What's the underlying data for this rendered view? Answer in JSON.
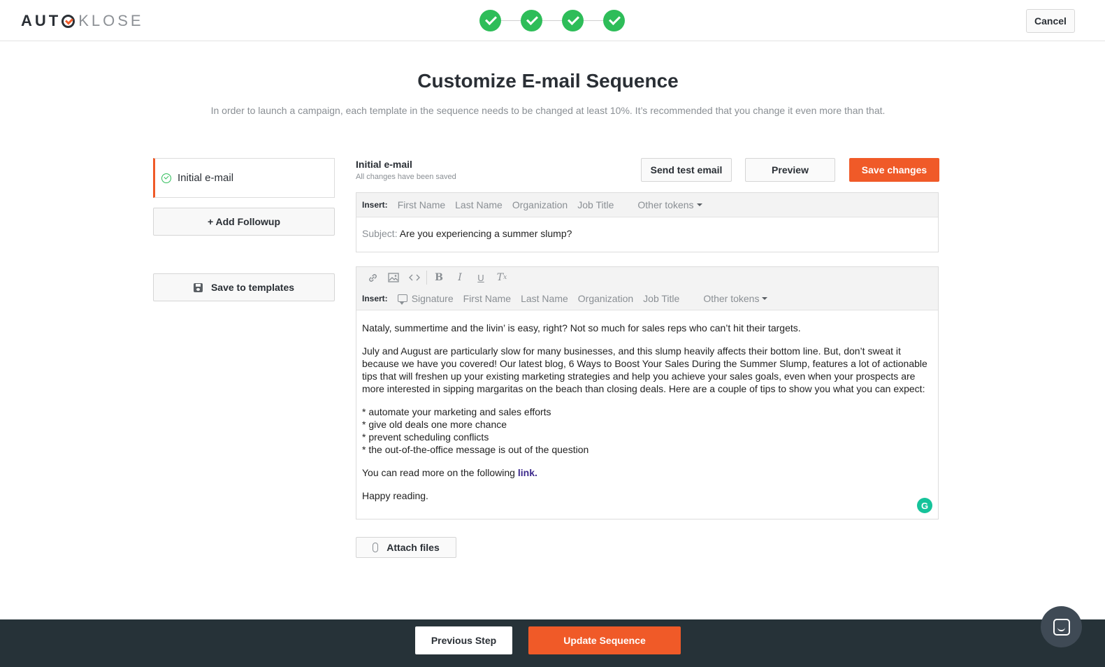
{
  "header": {
    "logo": {
      "part1": "AUT",
      "part2": "KLOSE"
    },
    "steps_completed": 4,
    "cancel_label": "Cancel"
  },
  "page": {
    "title": "Customize E-mail Sequence",
    "subtitle": "In order to launch a campaign, each template in the sequence needs to be changed at least 10%. It’s recommended that you change it even more than that."
  },
  "sidebar": {
    "sequence_items": [
      {
        "label": "Initial e-mail",
        "status": "complete"
      }
    ],
    "add_followup_label": "+ Add Followup",
    "save_templates_label": "Save to templates"
  },
  "email": {
    "title": "Initial e-mail",
    "status": "All changes have been saved",
    "send_test_label": "Send test email",
    "preview_label": "Preview",
    "save_label": "Save changes",
    "subject_insert": {
      "label": "Insert:",
      "tokens": [
        "First Name",
        "Last Name",
        "Organization",
        "Job Title"
      ],
      "other_label": "Other tokens"
    },
    "subject_prefix": "Subject:",
    "subject_value": "Are you experiencing a summer slump?",
    "body_insert": {
      "label": "Insert:",
      "signature_label": "Signature",
      "tokens": [
        "First Name",
        "Last Name",
        "Organization",
        "Job Title"
      ],
      "other_label": "Other tokens"
    },
    "body": {
      "p1": "Nataly, summertime and the livin’ is easy, right? Not so much for sales reps who can’t hit their targets.",
      "p2": "July and August are particularly slow for many businesses, and this slump heavily affects their bottom line. But, don’t sweat it because we have you covered! Our latest blog, 6 Ways to Boost Your Sales During the Summer Slump, features a lot of actionable tips that will freshen up your existing marketing strategies and help you achieve your sales goals, even when your prospects are more interested in sipping margaritas on the beach than closing deals. Here are a couple of tips to show you what you can expect:",
      "bullets": [
        "* automate your marketing and sales efforts",
        "* give old deals one more chance",
        "* prevent scheduling conflicts",
        "* the out-of-the-office message is out of the question"
      ],
      "p3_prefix": "You can read more on the following",
      "link_text": "link.",
      "p4": "Happy reading."
    },
    "attach_label": "Attach files"
  },
  "footer": {
    "prev_label": "Previous Step",
    "update_label": "Update Sequence"
  },
  "colors": {
    "accent": "#f05a28",
    "success": "#2ebd59",
    "footer_bg": "#263238",
    "link": "#3d2a8c"
  },
  "icons": [
    "check-icon",
    "floppy-disk-icon",
    "link-icon",
    "image-icon",
    "code-icon",
    "bold-icon",
    "italic-icon",
    "underline-icon",
    "clear-format-icon",
    "speech-bubble-icon",
    "caret-down-icon",
    "paperclip-icon",
    "grammarly-icon",
    "chat-icon"
  ]
}
